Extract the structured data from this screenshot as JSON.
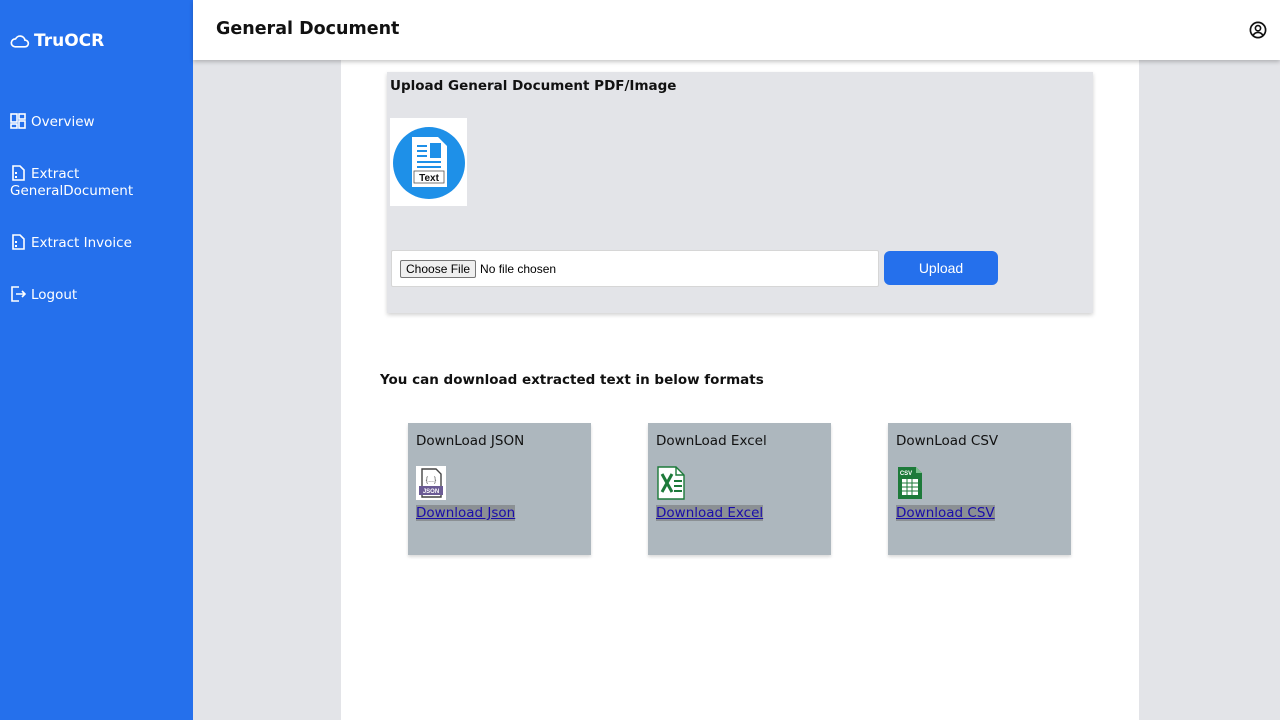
{
  "app": {
    "name": "TruOCR"
  },
  "sidebar": {
    "items": [
      {
        "label": "Overview",
        "icon": "dashboard-icon"
      },
      {
        "label": "Extract GeneralDocument",
        "icon": "document-icon"
      },
      {
        "label": "Extract Invoice",
        "icon": "document-icon"
      },
      {
        "label": "Logout",
        "icon": "logout-icon"
      }
    ]
  },
  "header": {
    "title": "General Document",
    "user_icon": "user-circle-icon"
  },
  "upload": {
    "title": "Upload General Document PDF/Image",
    "thumbnail_text": "Text",
    "choose_file_label": "Choose File",
    "file_status": "No file chosen",
    "upload_label": "Upload"
  },
  "downloads": {
    "heading": "You can download extracted text in below formats",
    "cards": [
      {
        "title": "DownLoad JSON",
        "link": "Download Json",
        "icon": "json-file-icon"
      },
      {
        "title": "DownLoad Excel",
        "link": "Download Excel",
        "icon": "excel-file-icon"
      },
      {
        "title": "DownLoad CSV",
        "link": "Download CSV",
        "icon": "csv-file-icon"
      }
    ]
  },
  "colors": {
    "accent": "#2570ec",
    "card_bg": "#adb7be",
    "content_bg": "#e3e4e8",
    "link": "#1a0dab"
  }
}
